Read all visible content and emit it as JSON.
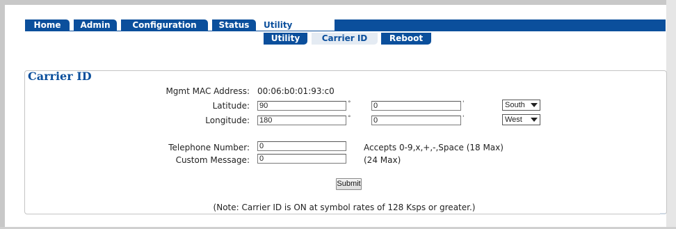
{
  "nav": {
    "tabs": [
      "Home",
      "Admin",
      "Configuration",
      "Status",
      "Utility"
    ],
    "active": "Utility",
    "subtabs": [
      "Utility",
      "Carrier ID",
      "Reboot"
    ],
    "active_subtab": "Carrier ID"
  },
  "panel": {
    "title": "Carrier ID",
    "mac_label": "Mgmt MAC Address:",
    "mac_value": "00:06:b0:01:93:c0",
    "latitude_label": "Latitude:",
    "latitude_degrees": "90",
    "latitude_minutes": "0",
    "latitude_direction": "South",
    "longitude_label": "Longitude:",
    "longitude_degrees": "180",
    "longitude_minutes": "0",
    "longitude_direction": "West",
    "degree_symbol": "°",
    "minute_symbol": "'",
    "phone_label": "Telephone Number:",
    "phone_value": "0",
    "phone_hint": "Accepts 0-9,x,+,-,Space (18 Max)",
    "message_label": "Custom Message:",
    "message_value": "0",
    "message_hint": "(24 Max)",
    "submit_label": "Submit",
    "note": "(Note: Carrier ID is ON at symbol rates of 128 Ksps or greater.)"
  },
  "colors": {
    "tab_blue": "#0b4f9c",
    "legend_blue": "#0b4f9c",
    "subtab_light": "#e4ebf3"
  }
}
